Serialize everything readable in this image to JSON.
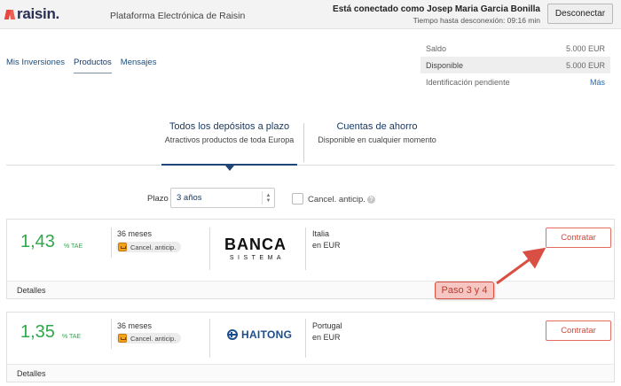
{
  "header": {
    "logo_text": "raisin.",
    "platform_title": "Plataforma Electrónica de Raisin",
    "connected_text": "Está conectado como Josep Maria Garcia Bonilla",
    "timeout_text": "Tiempo hasta desconexión: 09:16 min",
    "logout_label": "Desconectar"
  },
  "nav": {
    "items": [
      {
        "label": "Mis Inversiones"
      },
      {
        "label": "Productos"
      },
      {
        "label": "Mensajes"
      }
    ],
    "active": "Productos"
  },
  "balance": {
    "saldo_label": "Saldo",
    "saldo_value": "5.000 EUR",
    "disponible_label": "Disponible",
    "disponible_value": "5.000 EUR",
    "identificacion_label": "Identificación pendiente",
    "more_link": "Más"
  },
  "tabs": [
    {
      "title": "Todos los depósitos a plazo",
      "subtitle": "Atractivos productos de toda Europa"
    },
    {
      "title": "Cuentas de ahorro",
      "subtitle": "Disponible en cualquier momento"
    }
  ],
  "filters": {
    "plazo_label": "Plazo",
    "plazo_value": "3 años",
    "cancel_label": "Cancel. anticip.",
    "cancel_checked": false
  },
  "offers": [
    {
      "rate": "1,43",
      "rate_unit": "% TAE",
      "term": "36 meses",
      "badge": "Cancel. anticip.",
      "bank_logo_top": "BANCA",
      "bank_logo_bottom": "SISTEMA",
      "country": "Italia",
      "currency": "en EUR",
      "button": "Contratar",
      "details": "Detalles"
    },
    {
      "rate": "1,35",
      "rate_unit": "% TAE",
      "term": "36 meses",
      "badge": "Cancel. anticip.",
      "bank_logo": "HAITONG",
      "country": "Portugal",
      "currency": "en EUR",
      "button": "Contratar",
      "details": "Detalles"
    }
  ],
  "annotation": {
    "label": "Paso 3 y 4",
    "color": "#d94f44"
  },
  "colors": {
    "brand_red": "#e8473e",
    "brand_navy": "#2a2f55",
    "rate_green": "#2ea84a",
    "link_blue": "#2a6bb0"
  }
}
